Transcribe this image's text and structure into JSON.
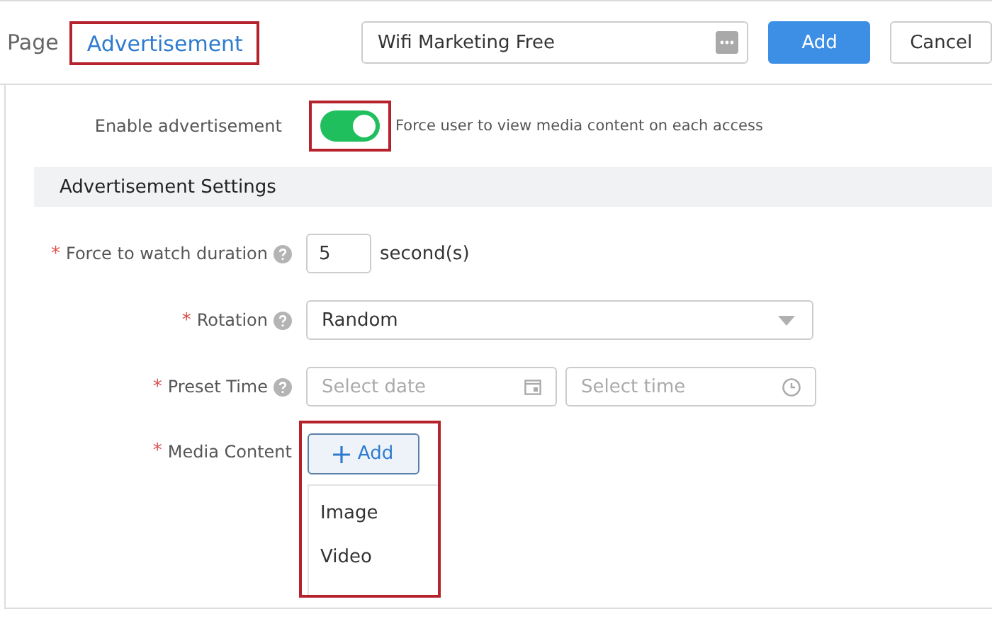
{
  "header": {
    "page_label": "Page",
    "tab": {
      "label": "Advertisement",
      "selected": true,
      "highlighted": true
    },
    "name_field": {
      "value": "Wifi Marketing Free"
    },
    "buttons": [
      {
        "label": "Add",
        "kind": "primary"
      },
      {
        "label": "Cancel",
        "kind": "default"
      }
    ]
  },
  "enable": {
    "label": "Enable advertisement",
    "on": true,
    "highlighted": true,
    "hint": "Force user to view media content on each access"
  },
  "section_title": "Advertisement Settings",
  "rows": [
    {
      "kind": "number",
      "required_mark": "*",
      "label": "Force to watch duration",
      "help": true,
      "value": "5",
      "unit": "second(s)"
    },
    {
      "kind": "select",
      "required_mark": "*",
      "label": "Rotation",
      "help": true,
      "value": "Random"
    },
    {
      "kind": "datetime",
      "required_mark": "*",
      "label": "Preset Time",
      "help": true,
      "date_placeholder": "Select date",
      "time_placeholder": "Select time"
    },
    {
      "kind": "add",
      "required_mark": "*",
      "label": "Media Content",
      "help": false,
      "button": "Add",
      "highlighted": true,
      "menu": [
        "Image",
        "Video"
      ]
    }
  ]
}
